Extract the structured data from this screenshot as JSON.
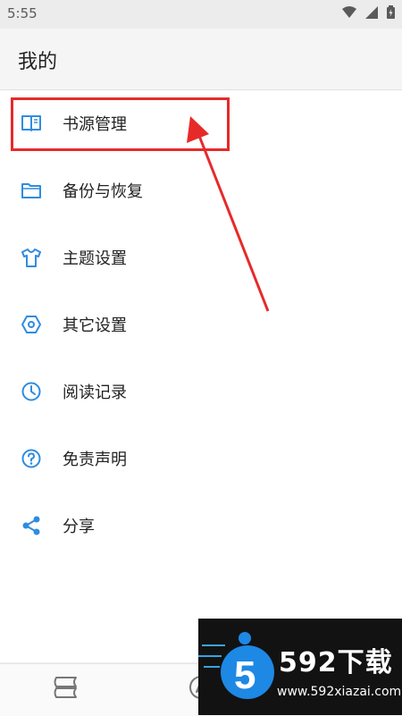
{
  "status": {
    "time": "5:55"
  },
  "app_bar": {
    "title": "我的"
  },
  "menu": {
    "items": [
      {
        "label": "书源管理",
        "icon": "book-icon"
      },
      {
        "label": "备份与恢复",
        "icon": "folder-icon"
      },
      {
        "label": "主题设置",
        "icon": "tshirt-icon"
      },
      {
        "label": "其它设置",
        "icon": "hexagon-settings-icon"
      },
      {
        "label": "阅读记录",
        "icon": "clock-icon"
      },
      {
        "label": "免责声明",
        "icon": "question-icon"
      },
      {
        "label": "分享",
        "icon": "share-icon"
      }
    ]
  },
  "colors": {
    "icon_blue": "#2f8ce0",
    "highlight_red": "#e62a2a",
    "text": "#222222"
  },
  "watermark": {
    "logo_text": "592下载",
    "url": "www.592xiazai.com"
  }
}
